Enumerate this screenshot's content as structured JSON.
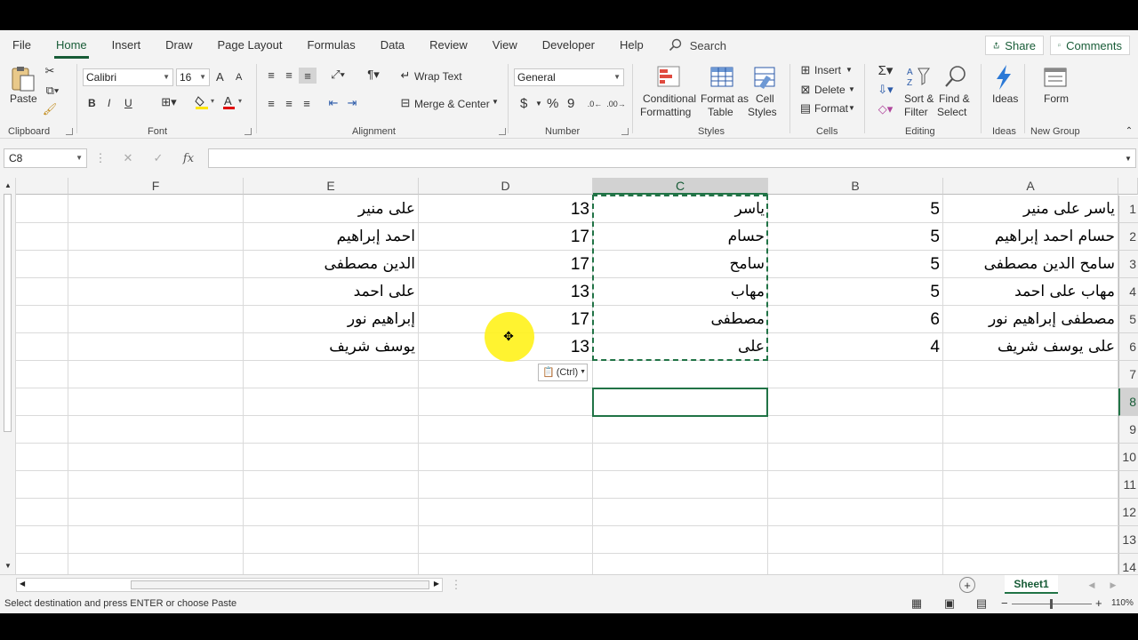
{
  "menu": {
    "tabs": [
      "File",
      "Home",
      "Insert",
      "Draw",
      "Page Layout",
      "Formulas",
      "Data",
      "Review",
      "View",
      "Developer",
      "Help"
    ],
    "active": "Home",
    "search": "Search",
    "share": "Share",
    "comments": "Comments"
  },
  "ribbon": {
    "clipboard": {
      "paste": "Paste",
      "label": "Clipboard"
    },
    "font": {
      "name": "Calibri",
      "size": "16",
      "label": "Font",
      "bold": "B",
      "italic": "I",
      "underline": "U",
      "grow": "A",
      "shrink": "A"
    },
    "alignment": {
      "wrap": "Wrap Text",
      "merge": "Merge & Center",
      "label": "Alignment"
    },
    "number": {
      "format": "General",
      "label": "Number",
      "currency": "$",
      "percent": "%",
      "comma": "9"
    },
    "styles": {
      "conditional": "Conditional",
      "conditional2": "Formatting",
      "format_table": "Format as",
      "format_table2": "Table",
      "cell_styles": "Cell",
      "cell_styles2": "Styles",
      "label": "Styles"
    },
    "cells": {
      "insert": "Insert",
      "delete": "Delete",
      "format": "Format",
      "label": "Cells"
    },
    "editing": {
      "sort": "Sort &",
      "sort2": "Filter",
      "find": "Find &",
      "find2": "Select",
      "label": "Editing"
    },
    "ideas": {
      "name": "Ideas",
      "label": "Ideas"
    },
    "newgroup": {
      "name": "Form",
      "label": "New Group"
    }
  },
  "formula_bar": {
    "name_box": "C8",
    "formula": ""
  },
  "columns": [
    "F",
    "E",
    "D",
    "C",
    "B",
    "A"
  ],
  "rows": [
    "1",
    "2",
    "3",
    "4",
    "5",
    "6",
    "7",
    "8",
    "9",
    "10",
    "11",
    "12",
    "13",
    "14"
  ],
  "cells": {
    "A": [
      "ياسر على منير",
      "حسام احمد إبراهيم",
      "سامح الدين مصطفى",
      "مهاب على احمد",
      "مصطفى إبراهيم نور",
      "على يوسف شريف"
    ],
    "B": [
      "5",
      "5",
      "5",
      "5",
      "6",
      "4"
    ],
    "C": [
      "ياسر",
      "حسام",
      "سامح",
      "مهاب",
      "مصطفى",
      "على"
    ],
    "D": [
      "13",
      "17",
      "17",
      "13",
      "17",
      "13"
    ],
    "E": [
      "على منير",
      "احمد إبراهيم",
      "الدين مصطفى",
      "على احمد",
      "إبراهيم نور",
      "يوسف شريف"
    ]
  },
  "paste_options": "(Ctrl)",
  "sheet": {
    "tab": "Sheet1"
  },
  "status": {
    "message": "Select destination and press ENTER or choose Paste",
    "zoom": "110%"
  },
  "colors": {
    "accent": "#217346",
    "cursor_highlight": "#fff21e"
  }
}
